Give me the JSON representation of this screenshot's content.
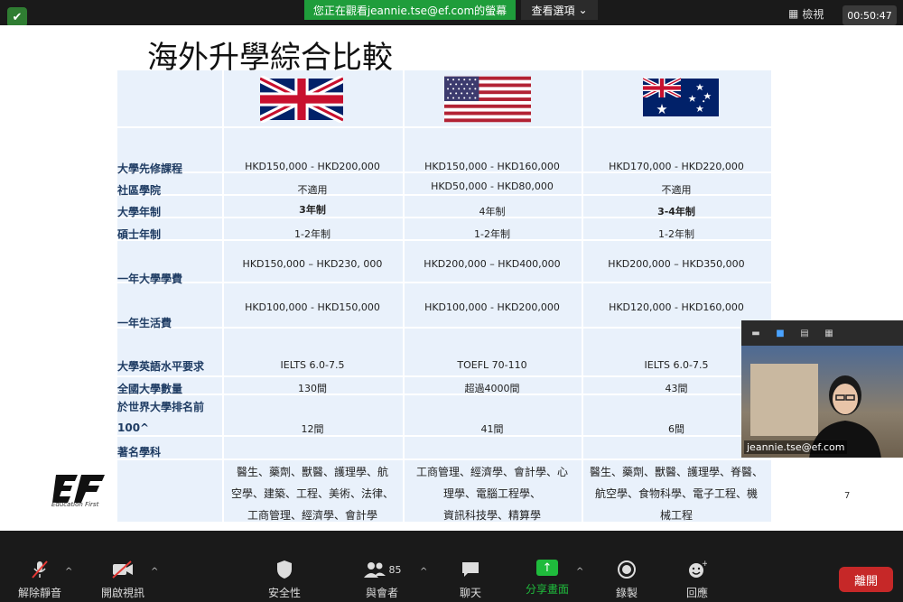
{
  "top_bar": {
    "share_banner": "您正在觀看jeannie.tse@ef.com的螢幕",
    "view_options": "查看選項",
    "view_button": "檢視",
    "timer": "00:50:47"
  },
  "slide": {
    "title": "海外升學綜合比較",
    "flags": [
      "uk-flag-icon",
      "us-flag-icon",
      "australia-flag-icon"
    ],
    "rows": [
      {
        "label": "大學先修課程",
        "uk": "HKD150,000 - HKD200,000",
        "us": "HKD150,000 - HKD160,000",
        "au": "HKD170,000 - HKD220,000"
      },
      {
        "label": "社區學院",
        "uk": "不適用",
        "us": "HKD50,000 - HKD80,000",
        "au": "不適用"
      },
      {
        "label": "大學年制",
        "uk": "3年制",
        "us": "4年制",
        "au": "3-4年制"
      },
      {
        "label": "碩士年制",
        "uk": "1-2年制",
        "us": "1-2年制",
        "au": "1-2年制"
      },
      {
        "label": "一年大學學費",
        "uk": "HKD150,000 – HKD230, 000",
        "us": "HKD200,000 – HKD400,000",
        "au": "HKD200,000 – HKD350,000"
      },
      {
        "label": "一年生活費",
        "uk": "HKD100,000 - HKD150,000",
        "us": "HKD100,000 - HKD200,000",
        "au": "HKD120,000 - HKD160,000"
      },
      {
        "label": "大學英語水平要求",
        "uk": "IELTS 6.0-7.5",
        "us": "TOEFL 70-110",
        "au": "IELTS 6.0-7.5"
      },
      {
        "label": "全國大學數量",
        "uk": "130間",
        "us": "超過4000間",
        "au": "43間"
      },
      {
        "label_line1": "於世界大學排名前",
        "label_line2": "100^",
        "uk": "12間",
        "us": "41間",
        "au": "6間"
      },
      {
        "label": "著名學科"
      }
    ],
    "famous_subjects": {
      "uk": [
        "醫生、藥劑、獸醫、護理學、航",
        "空學、建築、工程、美術、法律、",
        "工商管理、經濟學、會計學"
      ],
      "us": [
        "工商管理、經濟學、會計學、心",
        "理學、電腦工程學、",
        "資訊科技學、精算學"
      ],
      "au": [
        "醫生、藥劑、獸醫、護理學、脊醫、",
        "航空學、食物科學、電子工程、機",
        "械工程"
      ]
    },
    "logo_sub": "Education First",
    "page_number": "7"
  },
  "video": {
    "name": "jeannie.tse@ef.com"
  },
  "toolbar": {
    "unmute": "解除靜音",
    "start_video": "開啟視訊",
    "security": "安全性",
    "participants": "與會者",
    "participants_count": "85",
    "chat": "聊天",
    "share_screen": "分享畫面",
    "record": "錄製",
    "reactions": "回應",
    "leave": "離開"
  },
  "colors": {
    "share_green": "#1fbb3c",
    "leave_red": "#c62828",
    "table_bg": "#e9f1fb",
    "label_blue": "#1f3c63"
  }
}
